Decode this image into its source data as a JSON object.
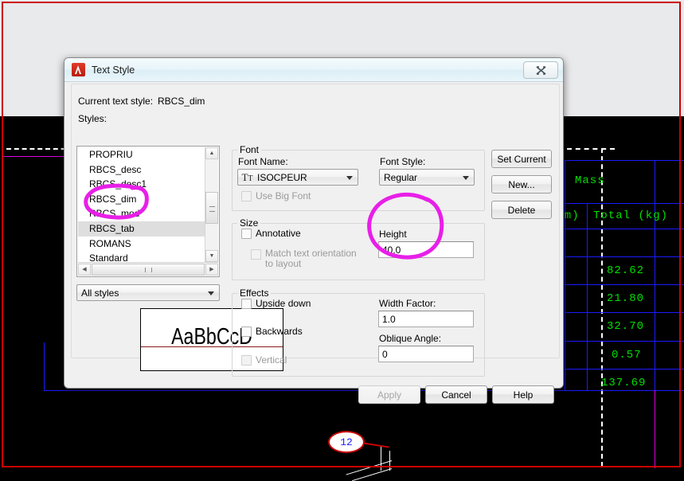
{
  "dialog": {
    "title": "Text Style",
    "close_label": "✕",
    "current_style_label": "Current text style:",
    "current_style_value": "RBCS_dim",
    "styles_label": "Styles:",
    "styles": [
      {
        "name": "PROPRIU",
        "selected": false
      },
      {
        "name": "RBCS_desc",
        "selected": false
      },
      {
        "name": "RBCS_desc1",
        "selected": false
      },
      {
        "name": "RBCS_dim",
        "selected": false
      },
      {
        "name": "RBCS_mod",
        "selected": false
      },
      {
        "name": "RBCS_tab",
        "selected": true
      },
      {
        "name": "ROMANS",
        "selected": false
      },
      {
        "name": "Standard",
        "selected": false
      }
    ],
    "filter": {
      "value": "All styles"
    },
    "font": {
      "group_label": "Font",
      "name_label": "Font Name:",
      "name_value": "ISOCPEUR",
      "name_icon": "truetype-icon",
      "style_label": "Font Style:",
      "style_value": "Regular",
      "big_font_label": "Use Big Font"
    },
    "size": {
      "group_label": "Size",
      "annotative_label": "Annotative",
      "match_orientation_label_1": "Match text orientation",
      "match_orientation_label_2": "to layout",
      "height_label": "Height",
      "height_value": "40.0"
    },
    "effects": {
      "group_label": "Effects",
      "upside_down_label": "Upside down",
      "backwards_label": "Backwards",
      "vertical_label": "Vertical",
      "width_factor_label": "Width Factor:",
      "width_factor_value": "1.0",
      "oblique_angle_label": "Oblique Angle:",
      "oblique_angle_value": "0"
    },
    "preview_text": "AaBbCcD",
    "side_buttons": {
      "set_current": "Set Current",
      "new": "New...",
      "delete": "Delete"
    },
    "footer_buttons": {
      "apply": "Apply",
      "cancel": "Cancel",
      "help": "Help"
    }
  },
  "cad": {
    "table": {
      "header_mass": "Mass",
      "header_unit": "g/m)",
      "header_total": "Total (kg)",
      "values": [
        "82.62",
        "21.80",
        "32.70",
        "0.57",
        "137.69"
      ]
    },
    "balloon_label": "12"
  },
  "colors": {
    "accent_red": "#cc0000",
    "cad_green": "#00e000",
    "cad_blue": "#1a1aff",
    "annotation_magenta": "#e81fe8",
    "dialog_face": "#f0f0f0",
    "titlebar": "#e9f5fa"
  }
}
